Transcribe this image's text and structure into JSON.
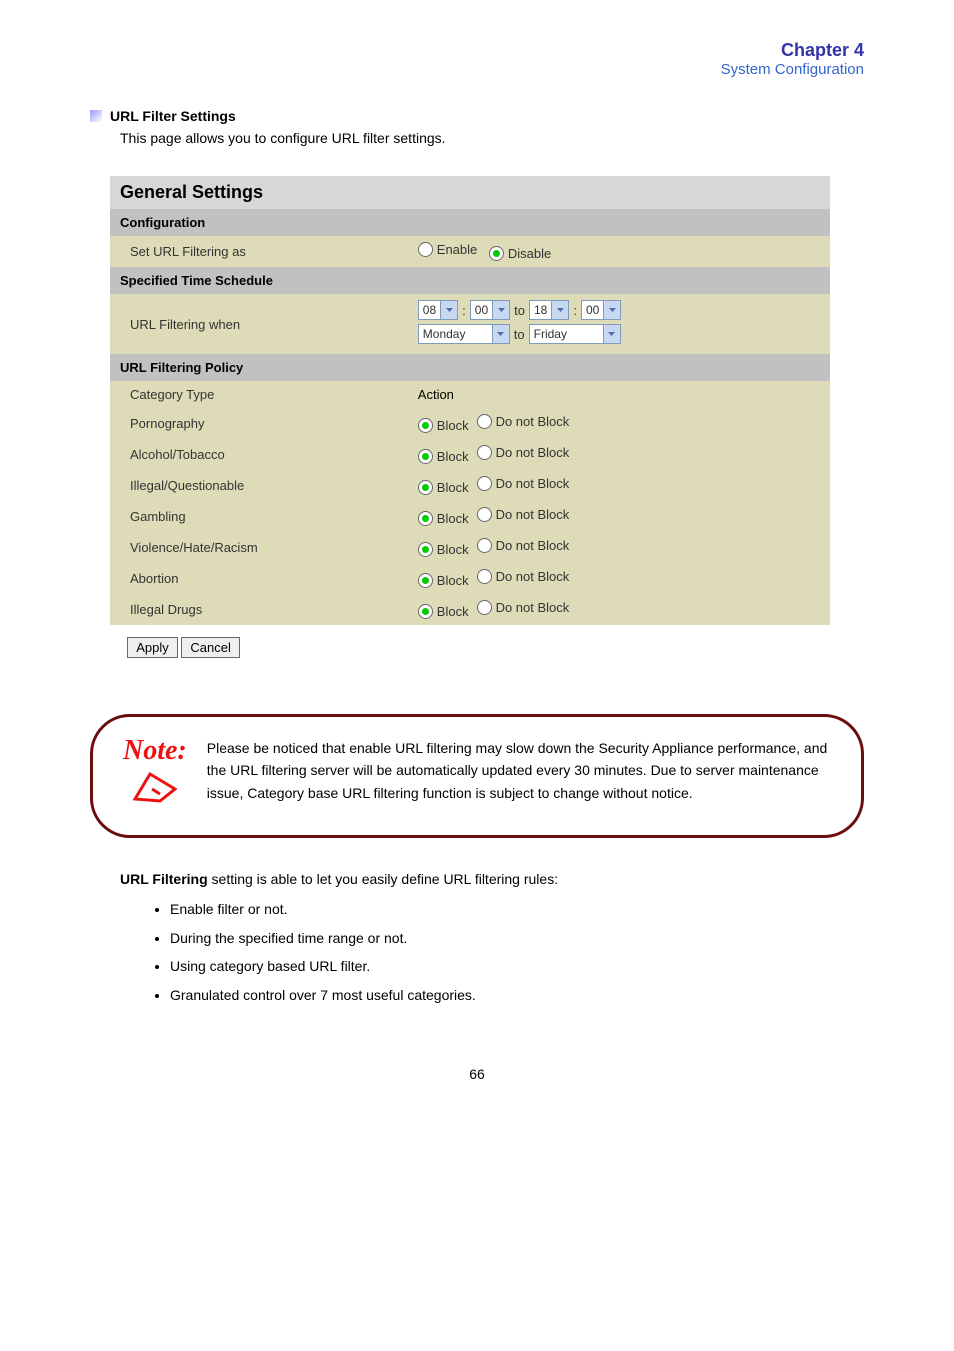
{
  "header": {
    "chapter": "Chapter 4",
    "section": "System Configuration"
  },
  "subsection": {
    "title": "URL Filter Settings",
    "intro": "This page allows you to configure URL filter settings."
  },
  "table": {
    "title": "General Settings",
    "section_configuration": "Configuration",
    "set_url_label": "Set URL Filtering as",
    "enable_label": "Enable",
    "disable_label": "Disable",
    "section_schedule": "Specified Time Schedule",
    "filter_when_label": "URL Filtering when",
    "time_from_hour": "08",
    "time_from_min": "00",
    "time_to_hour": "18",
    "time_to_min": "00",
    "colon": ":",
    "to": "to",
    "day_from": "Monday",
    "day_to": "Friday",
    "section_policy": "URL Filtering Policy",
    "col_category": "Category Type",
    "col_action": "Action",
    "block_label": "Block",
    "notblock_label": "Do not Block",
    "categories": [
      "Pornography",
      "Alcohol/Tobacco",
      "Illegal/Questionable",
      "Gambling",
      "Violence/Hate/Racism",
      "Abortion",
      "Illegal Drugs"
    ],
    "apply_label": "Apply",
    "cancel_label": "Cancel"
  },
  "note": {
    "prefix": "Note:",
    "text": "Please be noticed that enable URL filtering may slow down the Security Appliance performance, and the URL filtering server will be automatically updated every 30 minutes. Due to server maintenance issue, Category base URL filtering function is subject to change without notice."
  },
  "below": {
    "lead_bold": "URL Filtering",
    "lead_rest": "setting is able to let you easily define URL filtering rules:",
    "bullets": [
      "Enable filter or not.",
      "During the specified time range or not.",
      "Using category based URL filter.",
      "Granulated control over 7 most useful categories."
    ]
  },
  "page_number": "66"
}
